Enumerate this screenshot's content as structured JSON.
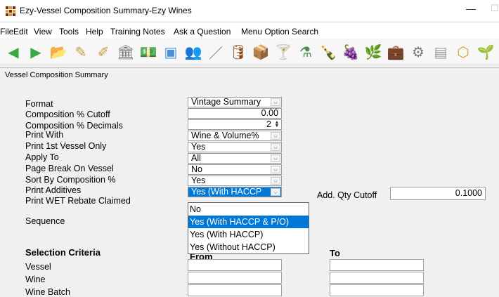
{
  "window": {
    "title": "Ezy-Vessel Composition Summary-Ezy Wines",
    "minimize": "—",
    "maximize": "☐"
  },
  "menu": [
    "File",
    "Edit",
    "View",
    "Tools",
    "Help",
    "Training Notes",
    "Ask a Question",
    "Menu Option Search"
  ],
  "toolbar": [
    {
      "icon": "back-arrow-icon",
      "glyph": "◀",
      "color": "#3aa845"
    },
    {
      "icon": "forward-arrow-icon",
      "glyph": "▶",
      "color": "#3aa845"
    },
    {
      "icon": "open-folder-icon",
      "glyph": "📂",
      "color": "#e0b030"
    },
    {
      "icon": "edit-icon",
      "glyph": "✎",
      "color": "#c49a3a"
    },
    {
      "icon": "note-edit-icon",
      "glyph": "✐",
      "color": "#c49a3a"
    },
    {
      "icon": "bank-icon",
      "glyph": "🏛",
      "color": "#777"
    },
    {
      "icon": "money-icon",
      "glyph": "💵",
      "color": "#4a9a4a"
    },
    {
      "icon": "screen-icon",
      "glyph": "▣",
      "color": "#4a90d9"
    },
    {
      "icon": "people-icon",
      "glyph": "👥",
      "color": "#d89a2a"
    },
    {
      "icon": "pen-icon",
      "glyph": "／",
      "color": "#777"
    },
    {
      "icon": "barrel-icon",
      "glyph": "🛢",
      "color": "#8b4513"
    },
    {
      "icon": "box-icon",
      "glyph": "📦",
      "color": "#d08a2a"
    },
    {
      "icon": "glass-icon",
      "glyph": "🍸",
      "color": "#999"
    },
    {
      "icon": "lab-icon",
      "glyph": "⚗",
      "color": "#4a8a4a"
    },
    {
      "icon": "wine-bottle-icon",
      "glyph": "🍾",
      "color": "#7a1a4a"
    },
    {
      "icon": "grapes-icon",
      "glyph": "🍇",
      "color": "#7a2a7a"
    },
    {
      "icon": "vine-icon",
      "glyph": "🌿",
      "color": "#3a8a3a"
    },
    {
      "icon": "briefcase-icon",
      "glyph": "💼",
      "color": "#c08a3a"
    },
    {
      "icon": "settings-icon",
      "glyph": "⚙",
      "color": "#777"
    },
    {
      "icon": "document-icon",
      "glyph": "▤",
      "color": "#999"
    },
    {
      "icon": "cube-icon",
      "glyph": "⬡",
      "color": "#d8a030"
    },
    {
      "icon": "plant-icon",
      "glyph": "🌱",
      "color": "#3a8a3a"
    }
  ],
  "form_title": "Vessel Composition Summary",
  "fields": {
    "format": {
      "label": "Format",
      "value": "Vintage Summary"
    },
    "cutoff": {
      "label": "Composition % Cutoff",
      "value": "0.00"
    },
    "decimals": {
      "label": "Composition % Decimals",
      "value": "2"
    },
    "print_with": {
      "label": "Print With",
      "value": "Wine & Volume%"
    },
    "print_first": {
      "label": "Print 1st Vessel Only",
      "value": "Yes"
    },
    "apply_to": {
      "label": "Apply To",
      "value": "All"
    },
    "page_break": {
      "label": "Page Break On Vessel",
      "value": "No"
    },
    "sort_by": {
      "label": "Sort By Composition %",
      "value": "Yes"
    },
    "print_additives": {
      "label": "Print Additives",
      "value": "Yes (With HACCP"
    },
    "wet_rebate": {
      "label": "Print WET Rebate Claimed"
    },
    "sequence": {
      "label": "Sequence"
    },
    "add_qty_cutoff": {
      "label": "Add. Qty Cutoff",
      "value": "0.1000"
    }
  },
  "dropdown_options": [
    "No",
    "Yes (With HACCP & P/O)",
    "Yes (With HACCP)",
    "Yes (Without HACCP)"
  ],
  "dropdown_active_index": 1,
  "selection": {
    "title": "Selection Criteria",
    "from_label": "From",
    "to_label": "To",
    "rows": [
      "Vessel",
      "Wine",
      "Wine Batch"
    ]
  }
}
